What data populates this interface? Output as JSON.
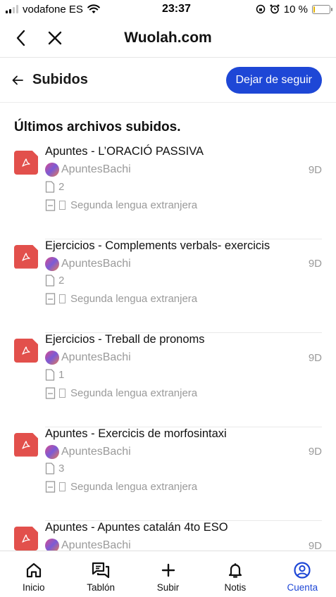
{
  "status_bar": {
    "carrier": "vodafone ES",
    "time": "23:37",
    "battery_percent": "10 %",
    "battery_level": 0.1
  },
  "browser": {
    "title": "Wuolah.com",
    "back_icon": "chevron-left-icon",
    "close_icon": "close-icon"
  },
  "page": {
    "title": "Subidos",
    "follow_button": "Dejar de seguir"
  },
  "section_title": "Últimos archivos subidos.",
  "files": [
    {
      "title": "Apuntes - L’ORACIÓ PASSIVA",
      "author": "ApuntesBachi",
      "age": "9D",
      "pages": "2",
      "subject": "Segunda lengua extranjera"
    },
    {
      "title": "Ejercicios - Complements verbals- exercicis",
      "author": "ApuntesBachi",
      "age": "9D",
      "pages": "2",
      "subject": "Segunda lengua extranjera"
    },
    {
      "title": "Ejercicios - Treball de pronoms",
      "author": "ApuntesBachi",
      "age": "9D",
      "pages": "1",
      "subject": "Segunda lengua extranjera"
    },
    {
      "title": "Apuntes - Exercicis de morfosintaxi",
      "author": "ApuntesBachi",
      "age": "9D",
      "pages": "3",
      "subject": "Segunda lengua extranjera"
    },
    {
      "title": "Apuntes - Apuntes catalán 4to ESO",
      "author": "ApuntesBachi",
      "age": "9D",
      "pages": "",
      "subject": ""
    }
  ],
  "bottom_nav": [
    {
      "label": "Inicio",
      "icon": "home-icon"
    },
    {
      "label": "Tablón",
      "icon": "chat-icon"
    },
    {
      "label": "Subir",
      "icon": "plus-icon"
    },
    {
      "label": "Notis",
      "icon": "bell-icon"
    },
    {
      "label": "Cuenta",
      "icon": "account-icon",
      "active": true
    }
  ],
  "colors": {
    "accent": "#1e47d6",
    "pdf": "#e2504c",
    "muted_text": "#9a9a9a"
  }
}
